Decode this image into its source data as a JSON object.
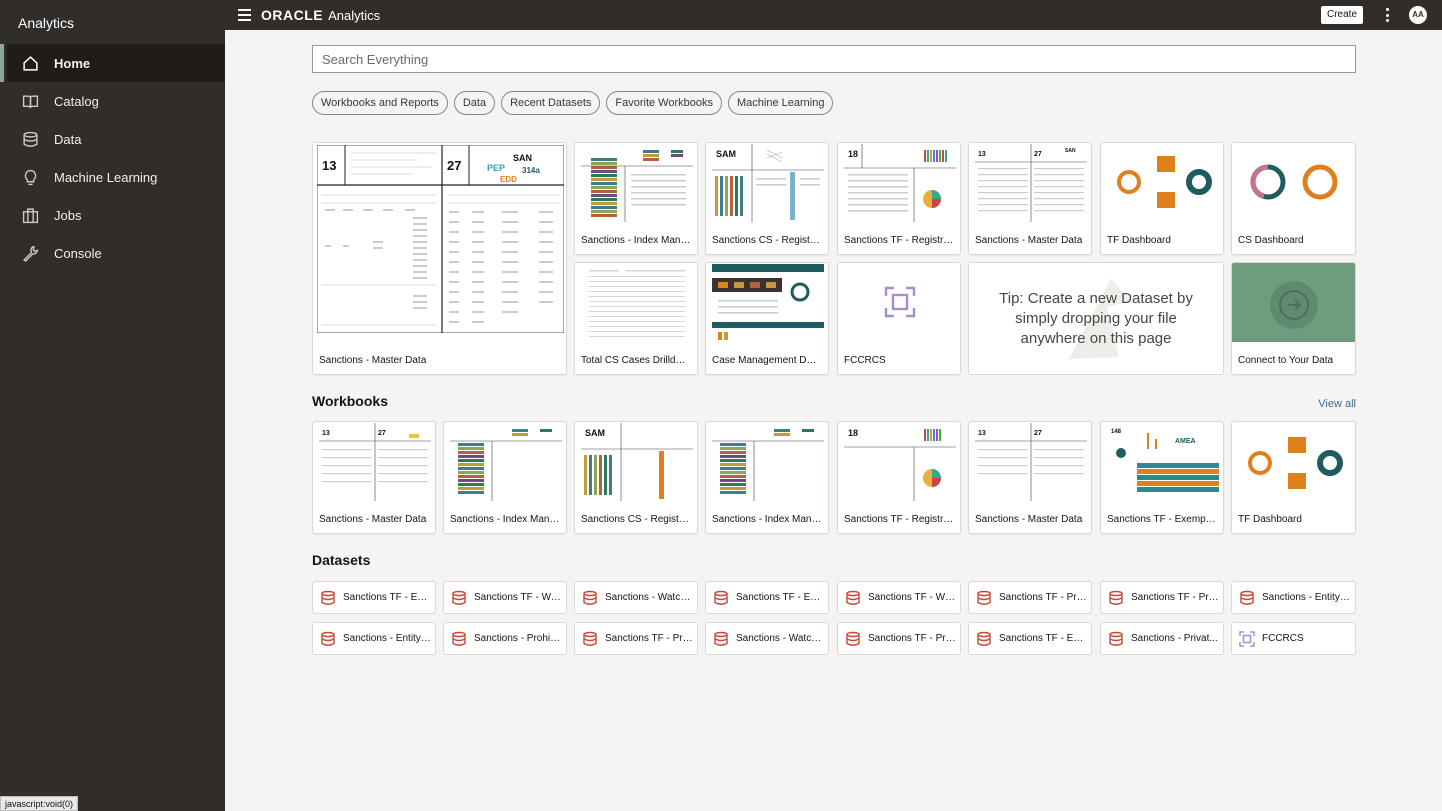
{
  "sidebar": {
    "title": "Analytics",
    "items": [
      {
        "label": "Home",
        "icon": "home-icon"
      },
      {
        "label": "Catalog",
        "icon": "book-icon"
      },
      {
        "label": "Data",
        "icon": "database-icon"
      },
      {
        "label": "Machine Learning",
        "icon": "lightbulb-icon"
      },
      {
        "label": "Jobs",
        "icon": "briefcase-icon"
      },
      {
        "label": "Console",
        "icon": "wrench-icon"
      }
    ]
  },
  "header": {
    "brand_oracle": "ORACLE",
    "brand_product": "Analytics",
    "create_label": "Create",
    "avatar_initials": "AA"
  },
  "search": {
    "placeholder": "Search Everything"
  },
  "chips": [
    "Workbooks and Reports",
    "Data",
    "Recent Datasets",
    "Favorite Workbooks",
    "Machine Learning"
  ],
  "recent": {
    "items": [
      "Sanctions - Master Data",
      "Sanctions - Index Mana...",
      "Sanctions CS - Registry ...",
      "Sanctions TF - Registry ...",
      "Sanctions - Master Data",
      "TF Dashboard",
      "CS Dashboard",
      "Total CS Cases Drilldown",
      "Case Management Dash...",
      "FCCRCS",
      "Connect to Your Data"
    ],
    "tip": "Tip: Create a new Dataset by simply dropping your file anywhere on this page",
    "thumb_text": {
      "n13": "13",
      "n27": "27",
      "pep": "PEP",
      "san": "SAN",
      "n314a": "314a",
      "edd": "EDD",
      "n18": "18",
      "sam": "SAM",
      "amea": "AMEA",
      "n148": "148"
    }
  },
  "workbooks": {
    "title": "Workbooks",
    "view_all": "View all",
    "items": [
      "Sanctions - Master Data",
      "Sanctions - Index Mana...",
      "Sanctions CS - Registry ...",
      "Sanctions - Index Mana...",
      "Sanctions TF - Registry ...",
      "Sanctions - Master Data",
      "Sanctions TF - Exemptio...",
      "TF Dashboard"
    ]
  },
  "datasets": {
    "title": "Datasets",
    "items": [
      "Sanctions TF - Eve...",
      "Sanctions TF - Wa...",
      "Sanctions - Watchl...",
      "Sanctions TF - Exe...",
      "Sanctions TF - Whi...",
      "Sanctions TF - Pro...",
      "Sanctions TF - Pro...",
      "Sanctions - Entity ...",
      "Sanctions - Entity ...",
      "Sanctions - Prohib...",
      "Sanctions TF - Pro...",
      "Sanctions - Watchl...",
      "Sanctions TF - Pro...",
      "Sanctions TF - Esc...",
      "Sanctions - Privat...",
      "FCCRCS"
    ]
  },
  "status_bar": "javascript:void(0)",
  "colors": {
    "sidebar_bg": "#312d2a",
    "accent_green": "#6d9d7e",
    "orange": "#e0801d",
    "teal": "#1f5c60",
    "dataset_red": "#c74634"
  }
}
